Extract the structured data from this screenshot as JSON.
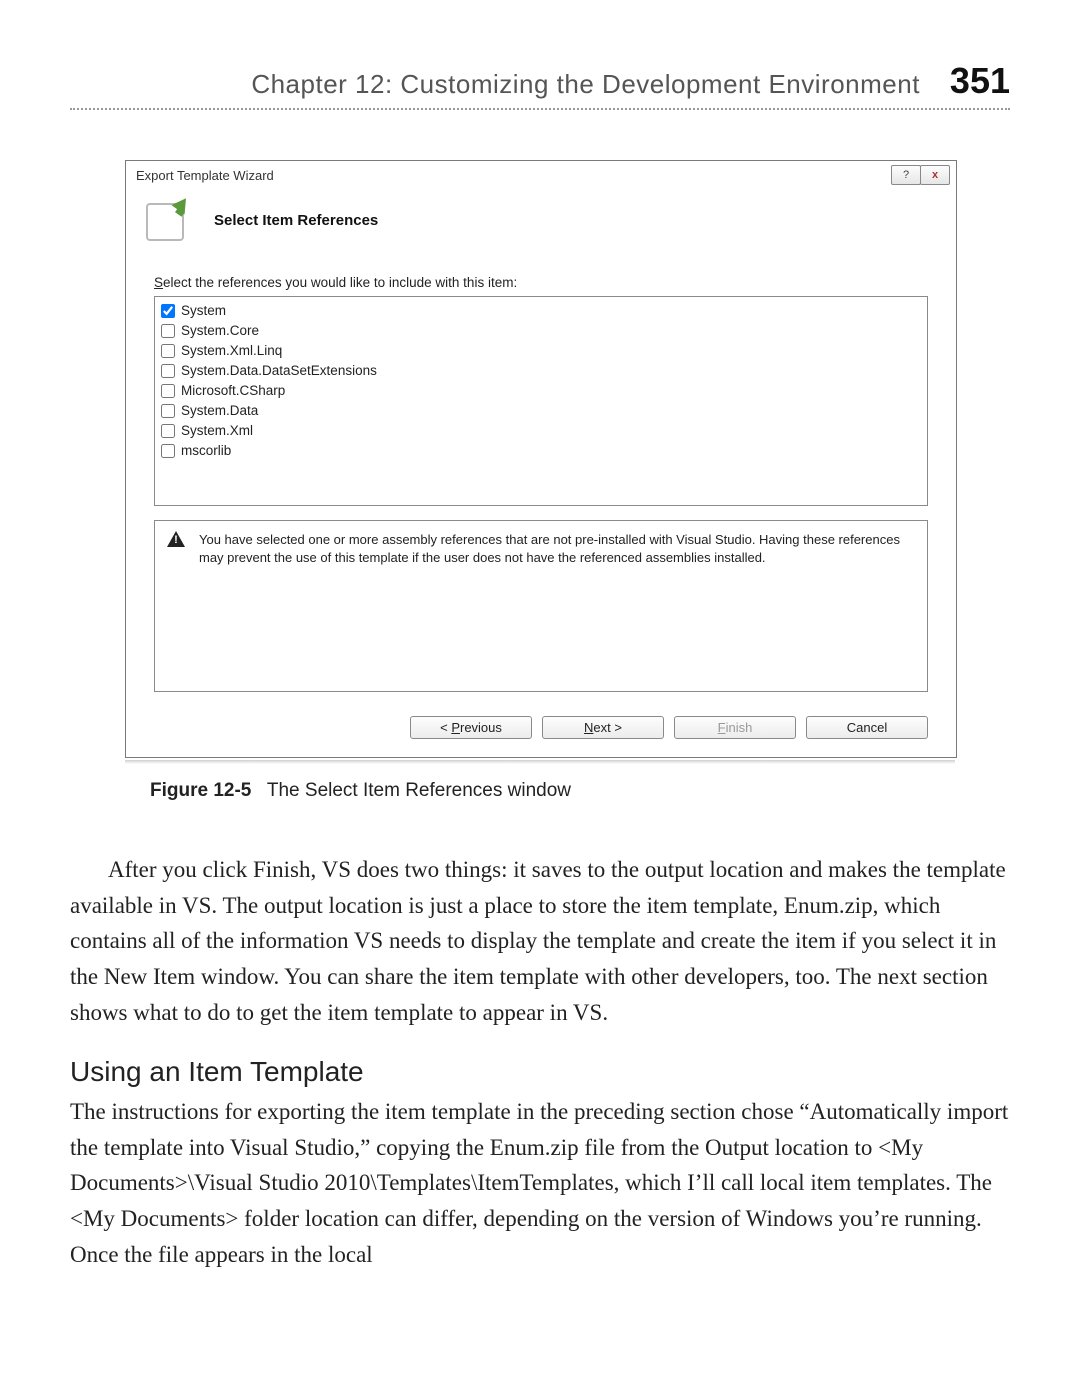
{
  "header": {
    "chapter_line": "Chapter 12:  Customizing the Development Environment",
    "page_number": "351"
  },
  "dialog": {
    "title": "Export Template Wizard",
    "banner_heading": "Select Item References",
    "prompt_pre": "S",
    "prompt_rest": "elect the references you would like to include with this item:",
    "references": [
      {
        "label": "System",
        "checked": true
      },
      {
        "label": "System.Core",
        "checked": false
      },
      {
        "label": "System.Xml.Linq",
        "checked": false
      },
      {
        "label": "System.Data.DataSetExtensions",
        "checked": false
      },
      {
        "label": "Microsoft.CSharp",
        "checked": false
      },
      {
        "label": "System.Data",
        "checked": false
      },
      {
        "label": "System.Xml",
        "checked": false
      },
      {
        "label": "mscorlib",
        "checked": false
      }
    ],
    "warning": "You have selected one or more assembly references that are not pre-installed with Visual Studio. Having these references may prevent the use of this template if the user does not have the referenced assemblies installed.",
    "buttons": {
      "previous_pre": "< ",
      "previous_u": "P",
      "previous_post": "revious",
      "next_u": "N",
      "next_post": "ext >",
      "finish_u": "F",
      "finish_post": "inish",
      "cancel": "Cancel"
    }
  },
  "caption": {
    "label": "Figure 12-5",
    "text": "The Select Item References window"
  },
  "body": {
    "p1": "After you click Finish, VS does two things: it saves to the output location and makes the template available in VS. The output location is just a place to store the item template, Enum.zip, which contains all of the information VS needs to display the template and create the item if you select it in the New Item window. You can share the item template with other developers, too. The next section shows what to do to get the item template to appear in VS.",
    "subhead": "Using an Item Template",
    "p2": "The instructions for exporting the item template in the preceding section chose “Automatically import the template into Visual Studio,” copying the Enum.zip file from the Output location to <My Documents>\\Visual Studio 2010\\Templates\\ItemTemplates, which I’ll call local item templates. The <My Documents> folder location can differ, depending on the version of Windows you’re running. Once the file appears in the local"
  }
}
